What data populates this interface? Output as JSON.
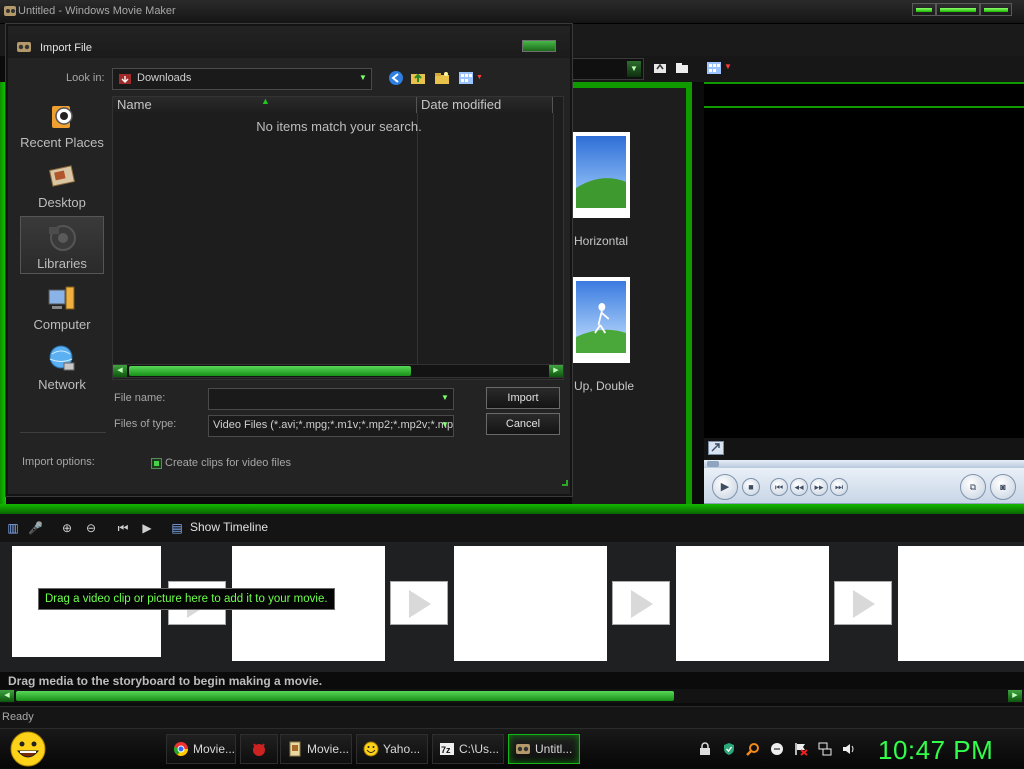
{
  "window": {
    "title": "Untitled - Windows Movie Maker"
  },
  "collection": {
    "items": [
      {
        "label": "Horizontal"
      },
      {
        "label": "Up, Double"
      }
    ]
  },
  "dialog": {
    "title": "Import File",
    "look_in_label": "Look in:",
    "look_in_value": "Downloads",
    "places": [
      {
        "label": "Recent Places",
        "icon": "recent-places-icon"
      },
      {
        "label": "Desktop",
        "icon": "desktop-icon"
      },
      {
        "label": "Libraries",
        "icon": "libraries-icon",
        "selected": true
      },
      {
        "label": "Computer",
        "icon": "computer-icon"
      },
      {
        "label": "Network",
        "icon": "network-icon"
      }
    ],
    "columns": [
      "Name",
      "Date modified"
    ],
    "empty_message": "No items match your search.",
    "file_name_label": "File name:",
    "file_name_value": "",
    "file_type_label": "Files of type:",
    "file_type_value": "Video Files (*.avi;*.mpg;*.m1v;*.mp2;*.mp2v;*.mp",
    "import_button": "Import",
    "cancel_button": "Cancel",
    "import_options_label": "Import options:",
    "create_clips_label": "Create clips for video files",
    "create_clips_checked": true
  },
  "storyboard": {
    "show_timeline_label": "Show Timeline",
    "tooltip": "Drag a video clip or picture here to add it to your movie.",
    "hint": "Drag media to the storyboard to begin making a movie."
  },
  "status": {
    "text": "Ready"
  },
  "taskbar": {
    "tasks": [
      {
        "label": "Movie...",
        "icon": "chrome-icon"
      },
      {
        "label": "",
        "icon": "devil-icon"
      },
      {
        "label": "Movie...",
        "icon": "document-icon"
      },
      {
        "label": "Yaho...",
        "icon": "yahoo-messenger-icon"
      },
      {
        "label": "C:\\Us...",
        "icon": "7zip-icon"
      },
      {
        "label": "Untitl...",
        "icon": "movie-maker-icon",
        "active": true
      }
    ],
    "clock": "10:47 PM"
  },
  "colors": {
    "accent_green": "#13c600",
    "clock_green": "#31ff4a",
    "tooltip_green": "#6cff4c"
  }
}
